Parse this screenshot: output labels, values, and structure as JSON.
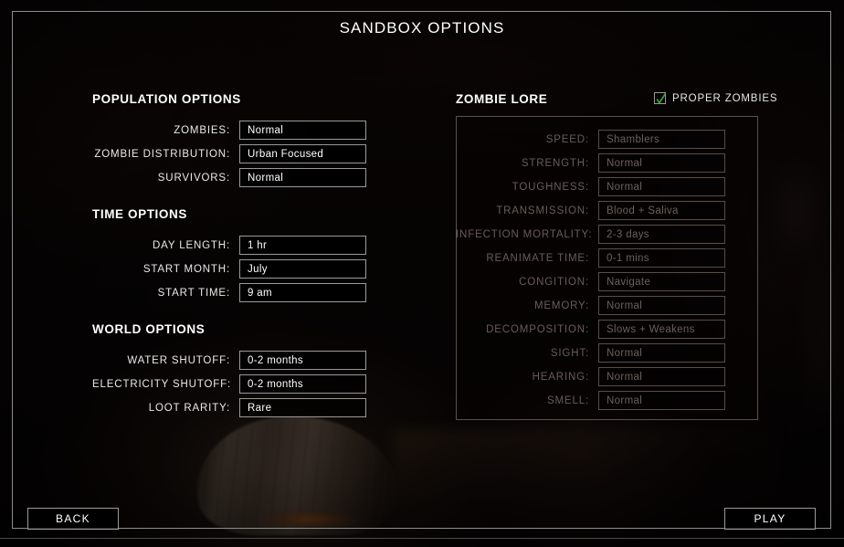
{
  "window": {
    "title": "SANDBOX OPTIONS"
  },
  "sections": {
    "population": {
      "heading": "POPULATION OPTIONS",
      "rows": [
        {
          "label": "ZOMBIES:",
          "value": "Normal"
        },
        {
          "label": "ZOMBIE DISTRIBUTION:",
          "value": "Urban Focused"
        },
        {
          "label": "SURVIVORS:",
          "value": "Normal"
        }
      ]
    },
    "time": {
      "heading": "TIME OPTIONS",
      "rows": [
        {
          "label": "DAY LENGTH:",
          "value": "1 hr"
        },
        {
          "label": "START MONTH:",
          "value": "July"
        },
        {
          "label": "START TIME:",
          "value": "9 am"
        }
      ]
    },
    "world": {
      "heading": "WORLD OPTIONS",
      "rows": [
        {
          "label": "WATER SHUTOFF:",
          "value": "0-2 months"
        },
        {
          "label": "ELECTRICITY SHUTOFF:",
          "value": "0-2 months"
        },
        {
          "label": "LOOT RARITY:",
          "value": "Rare"
        }
      ]
    },
    "lore": {
      "heading": "ZOMBIE LORE",
      "checkbox": {
        "label": "PROPER ZOMBIES",
        "checked": true,
        "check_color": "#3fa33f"
      },
      "rows": [
        {
          "label": "SPEED:",
          "value": "Shamblers"
        },
        {
          "label": "STRENGTH:",
          "value": "Normal"
        },
        {
          "label": "TOUGHNESS:",
          "value": "Normal"
        },
        {
          "label": "TRANSMISSION:",
          "value": "Blood + Saliva"
        },
        {
          "label": "INFECTION MORTALITY:",
          "value": "2-3 days"
        },
        {
          "label": "REANIMATE TIME:",
          "value": "0-1 mins"
        },
        {
          "label": "CONGITION:",
          "value": "Navigate"
        },
        {
          "label": "MEMORY:",
          "value": "Normal"
        },
        {
          "label": "DECOMPOSITION:",
          "value": "Slows + Weakens"
        },
        {
          "label": "SIGHT:",
          "value": "Normal"
        },
        {
          "label": "HEARING:",
          "value": "Normal"
        },
        {
          "label": "SMELL:",
          "value": "Normal"
        }
      ]
    }
  },
  "footer": {
    "back_label": "BACK",
    "play_label": "PLAY"
  },
  "colors": {
    "frame_border": "#8d8d8d",
    "text_primary": "#ffffff",
    "text_disabled": "#6a5c57",
    "field_border": "#9a9a9a",
    "panel_border": "#5b5048"
  }
}
